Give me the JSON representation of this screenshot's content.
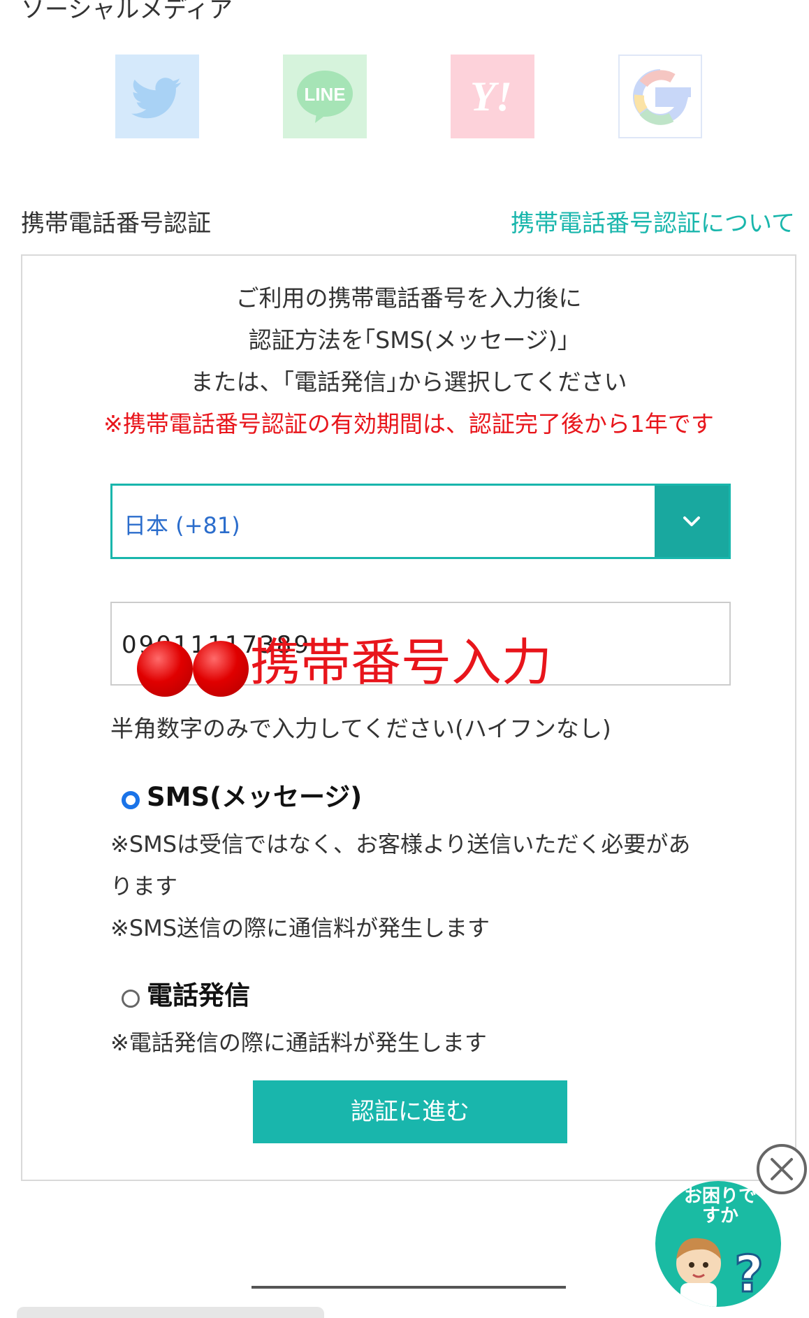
{
  "social": {
    "title": "ソーシャルメディア",
    "buttons": [
      {
        "name": "twitter",
        "color": "#1d9bf0"
      },
      {
        "name": "line",
        "label": "LINE",
        "color": "#06c755"
      },
      {
        "name": "yahoo",
        "label": "Y!",
        "color": "#ff0033"
      },
      {
        "name": "google",
        "label": "G",
        "color": "#4285f4"
      }
    ]
  },
  "phone_auth": {
    "title": "携帯電話番号認証",
    "about_link": "携帯電話番号認証について",
    "instructions": [
      "ご利用の携帯電話番号を入力後に",
      "認証方法を｢SMS(メッセージ)｣",
      "または、｢電話発信｣から選択してください"
    ],
    "warning": "※携帯電話番号認証の有効期間は、認証完了後から1年です",
    "country_select": {
      "value": "日本 (+81)"
    },
    "phone_input": {
      "value": "09011117389",
      "overlay": "携帯番号入力"
    },
    "hint": "半角数字のみで入力してください(ハイフンなし)",
    "options": {
      "sms": {
        "label": "SMS(メッセージ)",
        "selected": true,
        "note_1": "※SMSは受信ではなく、お客様より送信いただく必要があります",
        "note_2": "※SMS送信の際に通信料が発生します"
      },
      "tel": {
        "label": "電話発信",
        "selected": false,
        "note_1": "※電話発信の際に通話料が発生します"
      }
    },
    "submit": "認証に進む"
  },
  "help": {
    "text": "お困りですか",
    "mark": "?"
  },
  "colors": {
    "accent": "#19b6ac",
    "warning": "#e8151b",
    "radio": "#1a73e8"
  }
}
